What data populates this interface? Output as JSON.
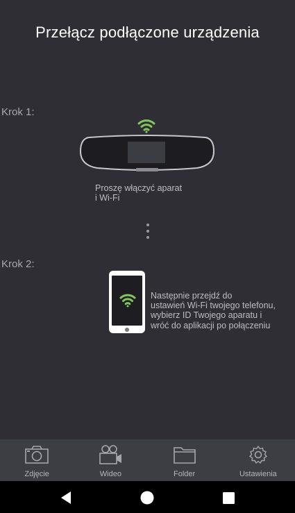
{
  "header": {
    "title": "Przełącz podłączone urządzenia"
  },
  "steps": [
    {
      "label": "Krok 1:",
      "text_lines": [
        "Proszę włączyć aparat",
        "i Wi-Fi"
      ]
    },
    {
      "label": "Krok 2:",
      "text_lines": [
        "Następnie przejdź do",
        "ustawień Wi-Fi twojego telefonu,",
        "wybierz ID Twojego aparatu i",
        "wróć do aplikacji po połączeniu"
      ]
    }
  ],
  "colors": {
    "background": "#2e2e34",
    "wifi_accent": "#7ec85a",
    "tabbar": "#3d3d44"
  },
  "tabbar": {
    "items": [
      {
        "label": "Zdjęcie",
        "icon": "camera-icon"
      },
      {
        "label": "Wideo",
        "icon": "video-camera-icon"
      },
      {
        "label": "Folder",
        "icon": "folder-icon"
      },
      {
        "label": "Ustawienia",
        "icon": "gear-icon"
      }
    ]
  },
  "navbar": {
    "icons": [
      "back-icon",
      "home-icon",
      "recent-apps-icon"
    ]
  }
}
